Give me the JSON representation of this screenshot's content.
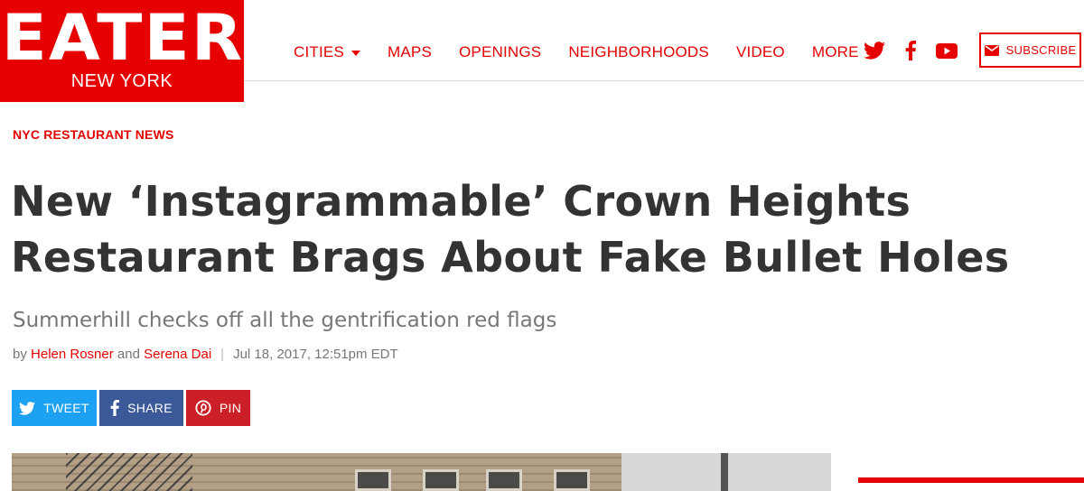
{
  "brand": {
    "logo": "EATER",
    "edition": "NEW YORK"
  },
  "nav": {
    "items": [
      {
        "label": "CITIES",
        "dropdown": true
      },
      {
        "label": "MAPS",
        "dropdown": false
      },
      {
        "label": "OPENINGS",
        "dropdown": false
      },
      {
        "label": "NEIGHBORHOODS",
        "dropdown": false
      },
      {
        "label": "VIDEO",
        "dropdown": false
      },
      {
        "label": "MORE",
        "dropdown": true
      }
    ],
    "social": [
      "twitter-icon",
      "facebook-icon",
      "youtube-icon"
    ],
    "subscribe_label": "SUBSCRIBE"
  },
  "article": {
    "kicker": "NYC RESTAURANT NEWS",
    "headline": "New ‘Instagrammable’ Crown Heights Restaurant Brags About Fake Bullet Holes",
    "dek": "Summerhill checks off all the gentrification red flags",
    "byline": {
      "prefix": "by",
      "author1": "Helen Rosner",
      "joiner": "and",
      "author2": "Serena Dai",
      "separator": "|",
      "date": "Jul 18, 2017, 12:51pm EDT"
    },
    "share": {
      "tweet_label": "TWEET",
      "share_label": "SHARE",
      "pin_label": "PIN"
    }
  },
  "colors": {
    "brand_red": "#e60000",
    "twitter_blue": "#1da1f2",
    "facebook_blue": "#3b5998",
    "pinterest_red": "#cb2027"
  }
}
